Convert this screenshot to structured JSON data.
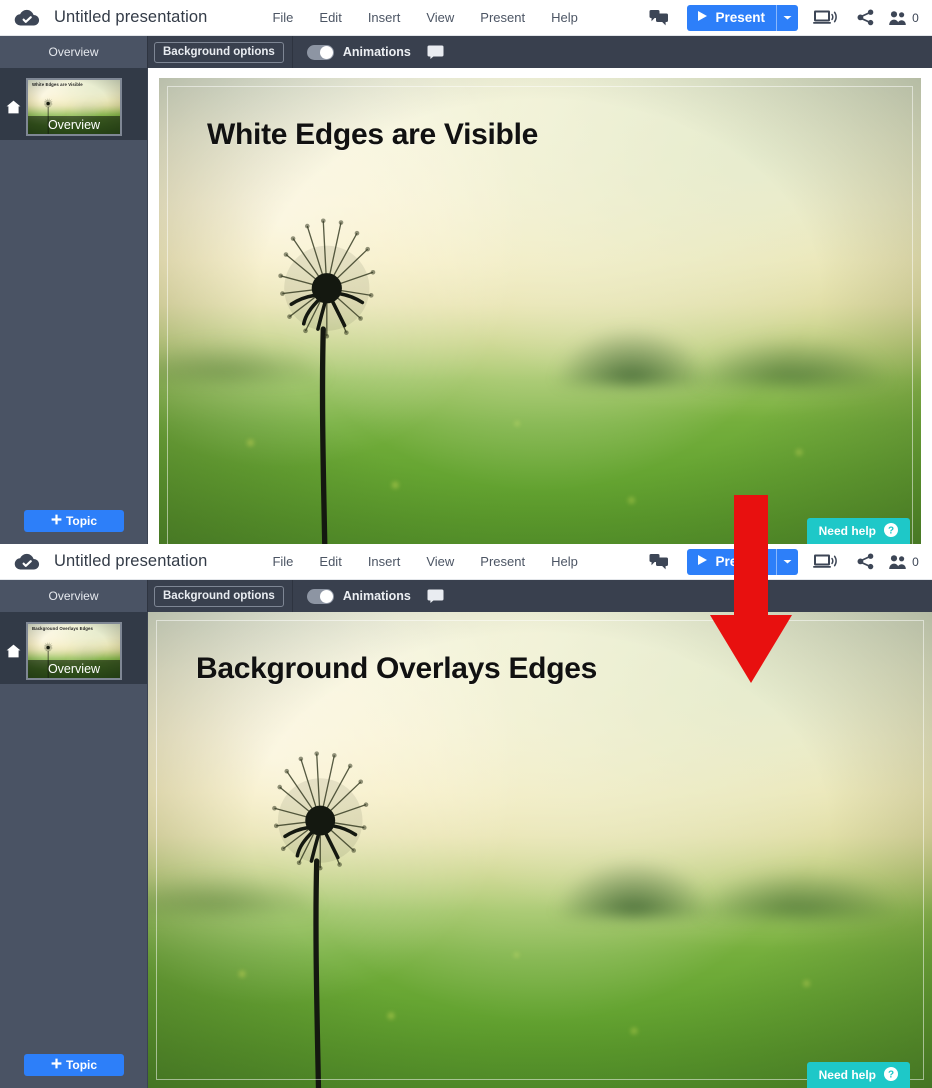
{
  "app": {
    "logo_icon": "cloud-check-icon",
    "title": "Untitled presentation",
    "menu": [
      "File",
      "Edit",
      "Insert",
      "View",
      "Present",
      "Help"
    ],
    "right_icons": [
      "chat-bubbles-icon",
      "cast-screen-icon",
      "share-icon",
      "collaborators-icon"
    ],
    "present_button": {
      "label": "Present",
      "play_icon": "play-triangle-icon",
      "caret_icon": "chevron-down-icon",
      "color": "#2d7ff9"
    },
    "collaborator_count": "0"
  },
  "subbar": {
    "overview_tab": "Overview",
    "background_options": "Background options",
    "animations_label": "Animations",
    "animations_toggle_on": true,
    "comment_icon": "comment-icon"
  },
  "sidebar": {
    "home_icon": "home-icon",
    "add_topic_label": "Topic",
    "add_icon": "plus-icon"
  },
  "panels": [
    {
      "id": "white-edges",
      "slide_heading": "White Edges are Visible",
      "thumb_title": "White Edges are Visible",
      "thumb_label": "Overview",
      "background_mode": "inset",
      "need_help": {
        "label": "Need help",
        "icon": "question-circle-icon",
        "color": "#1ec8c8"
      }
    },
    {
      "id": "background-overlays",
      "slide_heading": "Background Overlays Edges",
      "thumb_title": "Background Overlays Edges",
      "thumb_label": "Overview",
      "background_mode": "bleed",
      "need_help": {
        "label": "Need help",
        "icon": "question-circle-icon",
        "color": "#1ec8c8"
      }
    }
  ],
  "annotation": {
    "shape": "down-arrow",
    "color": "#e8100f"
  },
  "colors": {
    "appbar_bg": "#ffffff",
    "subbar_bg": "#39404e",
    "sidebar_bg": "#4a5364",
    "accent_blue": "#2d7ff9",
    "teal": "#1ec8c8",
    "arrow_red": "#e8100f"
  }
}
